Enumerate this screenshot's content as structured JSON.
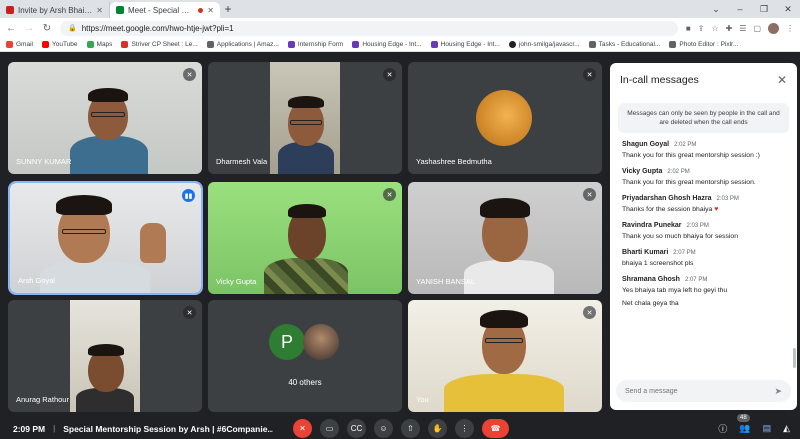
{
  "browser": {
    "tabs": [
      {
        "title": "Invite by Arsh Bhaiya | Mentorship",
        "favicon_color": "#c5221f"
      },
      {
        "title": "Meet - Special Mentorship S",
        "favicon_color": "#00832d",
        "active": true
      }
    ],
    "new_tab": "+",
    "url": "https://meet.google.com/hwo-htje-jwt?pli=1",
    "bookmarks": [
      {
        "label": "Gmail",
        "color": "#ea4335"
      },
      {
        "label": "YouTube",
        "color": "#ff0000"
      },
      {
        "label": "Maps",
        "color": "#34a853"
      },
      {
        "label": "Striver CP Sheet : Le...",
        "color": "#d93025"
      },
      {
        "label": "Applications | Amaz...",
        "color": "#5f6368"
      },
      {
        "label": "Internship Form",
        "color": "#673ab7"
      },
      {
        "label": "Housing Edge - Int...",
        "color": "#673ab7"
      },
      {
        "label": "Housing Edge - Int...",
        "color": "#673ab7"
      },
      {
        "label": "john-smilga/javascr...",
        "color": "#202124"
      },
      {
        "label": "Tasks - Educational...",
        "color": "#5f6368"
      },
      {
        "label": "Photo Editor : Pixlr...",
        "color": "#5f6368"
      }
    ]
  },
  "participants": [
    {
      "name": "SUNNY KUMAR",
      "muted": true
    },
    {
      "name": "Dharmesh Vala",
      "muted": true
    },
    {
      "name": "Yashashree Bedmutha",
      "muted": true
    },
    {
      "name": "Arsh Goyal",
      "speaking": true
    },
    {
      "name": "Vicky Gupta",
      "muted": true
    },
    {
      "name": "YANISH BANSAL",
      "muted": true
    },
    {
      "name": "Anurag Rathour",
      "muted": true
    },
    {
      "name": "40 others",
      "initial": "P"
    },
    {
      "name": "You",
      "muted": true
    }
  ],
  "chat": {
    "title": "In-call messages",
    "notice": "Messages can only be seen by people in the call and are deleted when the call ends",
    "messages": [
      {
        "sender": "Shagun Goyal",
        "time": "2:02 PM",
        "lines": [
          "Thank you for this great mentorship session :)"
        ]
      },
      {
        "sender": "Vicky Gupta",
        "time": "2:02 PM",
        "lines": [
          "Thank you for this great mentorship session."
        ]
      },
      {
        "sender": "Priyadarshan Ghosh Hazra",
        "time": "2:03 PM",
        "lines": [
          "Thanks for the session bhaiya"
        ]
      },
      {
        "sender": "Ravindra Punekar",
        "time": "2:03 PM",
        "lines": [
          "Thank you so much bhaiya for session"
        ]
      },
      {
        "sender": "Bharti Kumari",
        "time": "2:07 PM",
        "lines": [
          "bhaiya 1 screenshot pls"
        ]
      },
      {
        "sender": "Shramana Ghosh",
        "time": "2:07 PM",
        "lines": [
          "Yes bhaiya tab mya left ho geyi thu",
          "Net chala geya tha"
        ]
      }
    ],
    "input_placeholder": "Send a message"
  },
  "bottom": {
    "time": "2:09 PM",
    "separator": "|",
    "meeting_title": "Special Mentorship Session by Arsh | #6Companie...",
    "participant_count": "48"
  }
}
